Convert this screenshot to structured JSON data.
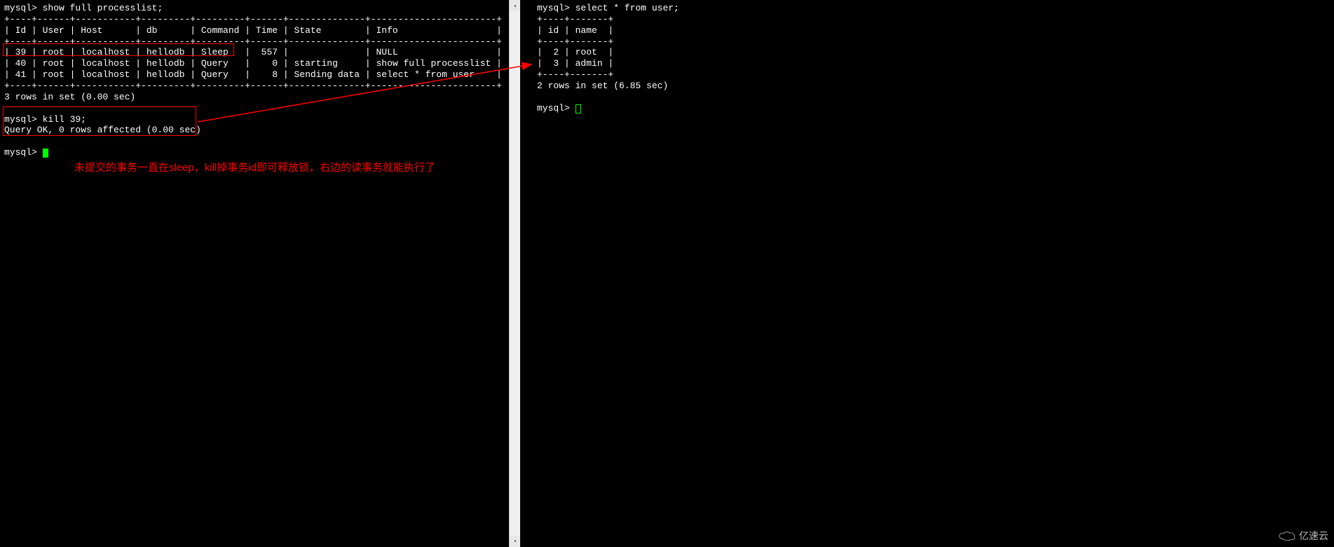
{
  "left_terminal": {
    "prompt": "mysql>",
    "cmd1": "show full processlist;",
    "divider": "+----+------+-----------+---------+---------+------+--------------+-----------------------+",
    "header": "| Id | User | Host      | db      | Command | Time | State        | Info                  |",
    "rows": [
      "| 39 | root | localhost | hellodb | Sleep   |  557 |              | NULL                  |",
      "| 40 | root | localhost | hellodb | Query   |    0 | starting     | show full processlist |",
      "| 41 | root | localhost | hellodb | Query   |    8 | Sending data | select * from user    |"
    ],
    "summary": "3 rows in set (0.00 sec)",
    "cmd2": "kill 39;",
    "result2": "Query OK, 0 rows affected (0.00 sec)"
  },
  "right_terminal": {
    "prompt": "mysql>",
    "cmd1": "select * from user;",
    "divider": "+----+-------+",
    "header": "| id | name  |",
    "rows": [
      "|  2 | root  |",
      "|  3 | admin |"
    ],
    "summary": "2 rows in set (6.85 sec)"
  },
  "annotation": {
    "text": "未提交的事务一直在sleep，kill掉事务id即可释放锁，右边的读事务就能执行了"
  },
  "watermark": {
    "text": "亿速云"
  },
  "processlist_data": {
    "columns": [
      "Id",
      "User",
      "Host",
      "db",
      "Command",
      "Time",
      "State",
      "Info"
    ],
    "rows": [
      {
        "Id": 39,
        "User": "root",
        "Host": "localhost",
        "db": "hellodb",
        "Command": "Sleep",
        "Time": 557,
        "State": "",
        "Info": "NULL"
      },
      {
        "Id": 40,
        "User": "root",
        "Host": "localhost",
        "db": "hellodb",
        "Command": "Query",
        "Time": 0,
        "State": "starting",
        "Info": "show full processlist"
      },
      {
        "Id": 41,
        "User": "root",
        "Host": "localhost",
        "db": "hellodb",
        "Command": "Query",
        "Time": 8,
        "State": "Sending data",
        "Info": "select * from user"
      }
    ]
  },
  "user_table_data": {
    "columns": [
      "id",
      "name"
    ],
    "rows": [
      {
        "id": 2,
        "name": "root"
      },
      {
        "id": 3,
        "name": "admin"
      }
    ]
  }
}
